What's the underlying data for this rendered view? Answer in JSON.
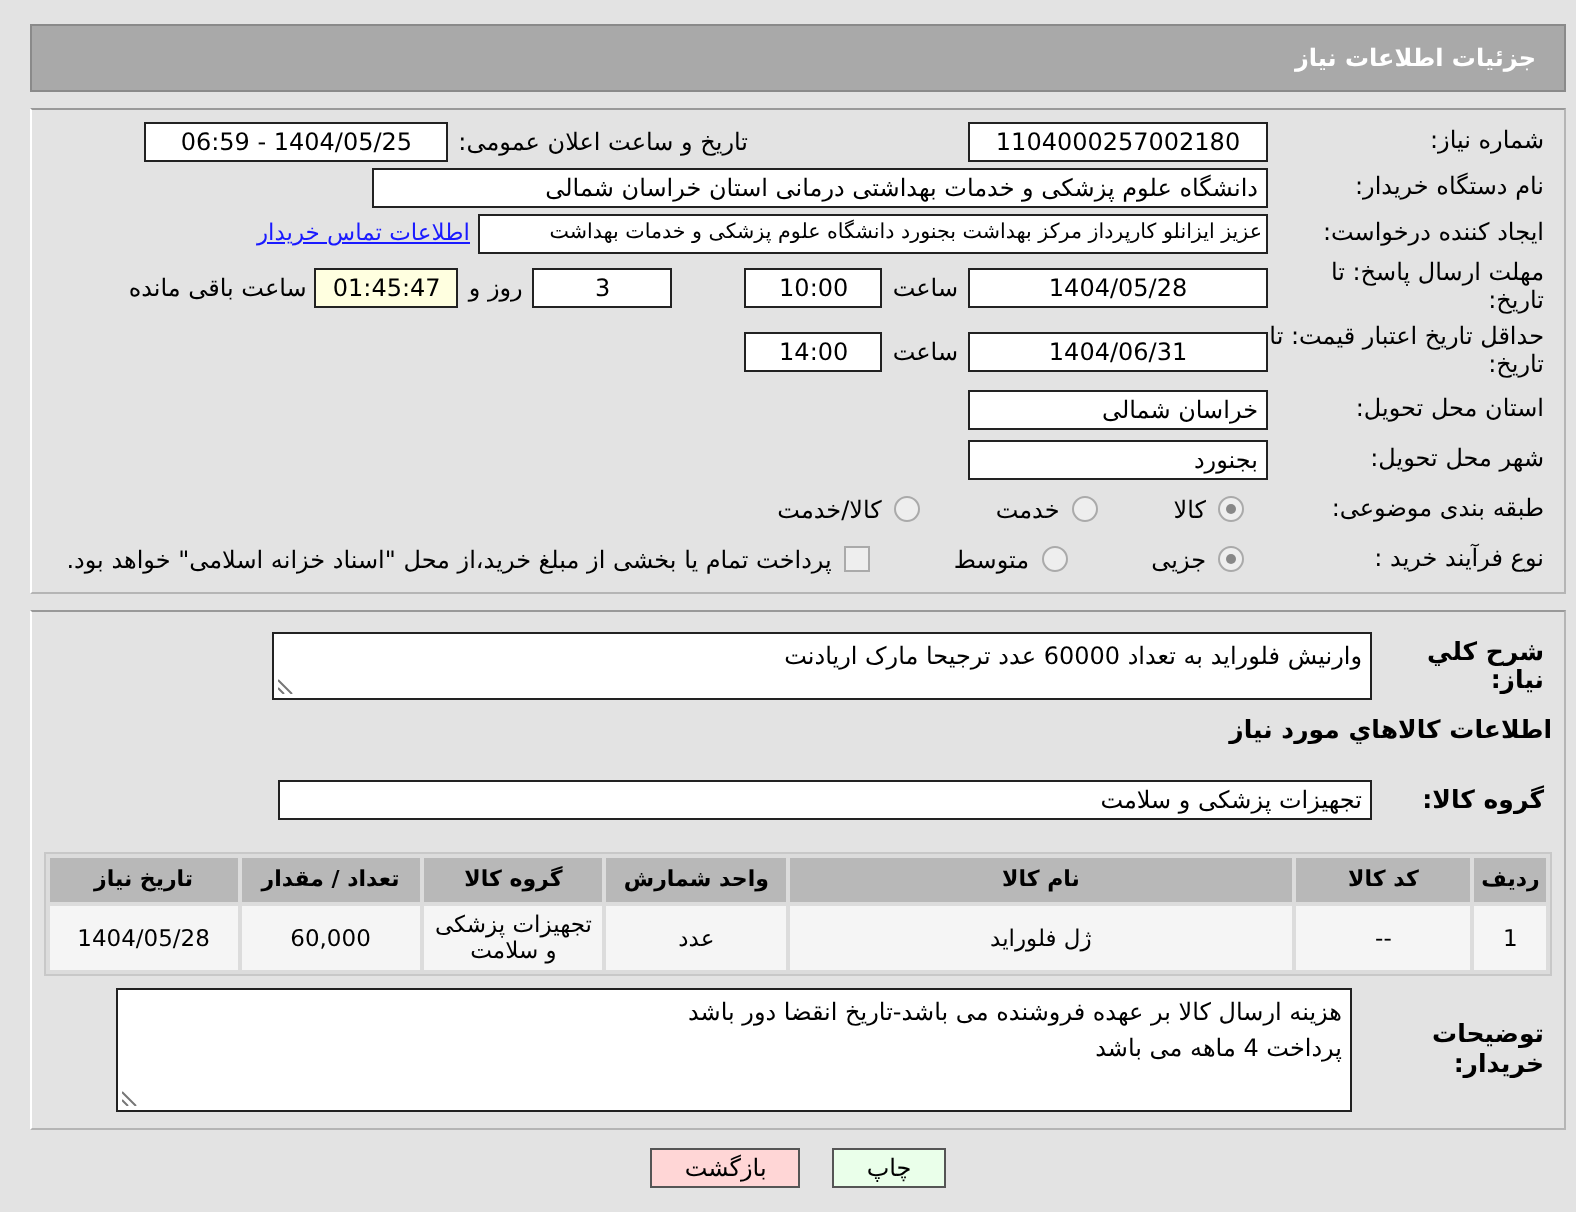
{
  "header": {
    "title": "جزئیات اطلاعات نیاز"
  },
  "need_number": {
    "label": "شماره نیاز:",
    "value": "1104000257002180"
  },
  "announce": {
    "label": "تاریخ و ساعت اعلان عمومی:",
    "value": "1404/05/25 - 06:59"
  },
  "buyer_org": {
    "label": "نام دستگاه خریدار:",
    "value": "دانشگاه علوم پزشکی و خدمات بهداشتی درمانی استان خراسان شمالی"
  },
  "requester": {
    "label": "ایجاد کننده درخواست:",
    "value": "عزیز ایزانلو کارپرداز مرکز بهداشت بجنورد دانشگاه علوم پزشکی و خدمات بهداشت",
    "link": "اطلاعات تماس خریدار"
  },
  "reply_deadline": {
    "label": "مهلت ارسال پاسخ: تا تاریخ:",
    "date": "1404/05/28",
    "time_label": "ساعت",
    "time": "10:00",
    "days": "3",
    "days_label": "روز و",
    "remaining": "01:45:47",
    "remaining_label": "ساعت باقی مانده"
  },
  "price_validity": {
    "label": "حداقل تاریخ اعتبار قیمت: تا تاریخ:",
    "date": "1404/06/31",
    "time_label": "ساعت",
    "time": "14:00"
  },
  "province": {
    "label": "استان محل تحویل:",
    "value": "خراسان شمالی"
  },
  "city": {
    "label": "شهر محل تحویل:",
    "value": "بجنورد"
  },
  "category": {
    "label": "طبقه بندی موضوعی:",
    "options": [
      {
        "label": "کالا",
        "selected": true
      },
      {
        "label": "خدمت",
        "selected": false
      },
      {
        "label": "کالا/خدمت",
        "selected": false
      }
    ]
  },
  "process": {
    "label": "نوع فرآیند خرید :",
    "options": [
      {
        "label": "جزیی",
        "selected": true
      },
      {
        "label": "متوسط",
        "selected": false
      }
    ],
    "payment_note": {
      "label": "پرداخت تمام یا بخشی از مبلغ خرید،از محل \"اسناد خزانه اسلامی\" خواهد بود.",
      "checked": false
    }
  },
  "description": {
    "label": "شرح کلي نياز:",
    "value": "وارنیش فلوراید به تعداد 60000 عدد ترجیحا مارک اریادنت"
  },
  "goods_heading": "اطلاعات کالاهاي مورد نياز",
  "goods_group": {
    "label": "گروه کالا:",
    "value": "تجهیزات پزشکی و سلامت"
  },
  "table": {
    "columns": [
      "ردیف",
      "کد کالا",
      "نام کالا",
      "واحد شمارش",
      "گروه کالا",
      "تعداد / مقدار",
      "تاریخ نیاز"
    ],
    "rows": [
      [
        "1",
        "--",
        "ژل فلوراید",
        "عدد",
        "تجهیزات پزشکی و سلامت",
        "60,000",
        "1404/05/28"
      ]
    ]
  },
  "buyer_notes": {
    "label": "توضیحات خریدار:",
    "lines": [
      "هزینه ارسال کالا بر عهده فروشنده می باشد-تاریخ انقضا دور باشد",
      "پرداخت 4 ماهه می باشد"
    ]
  },
  "buttons": [
    {
      "label": "چاپ",
      "kind": "print"
    },
    {
      "label": "بازگشت",
      "kind": "back"
    }
  ]
}
